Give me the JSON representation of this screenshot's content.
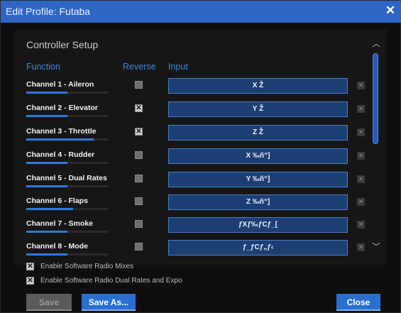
{
  "window": {
    "title": "Edit Profile: Futaba",
    "close_glyph": "✕"
  },
  "section_title": "Controller Setup",
  "columns": {
    "function": "Function",
    "reverse": "Reverse",
    "input": "Input"
  },
  "channels": [
    {
      "label": "Channel 1 - Aileron",
      "reverse": false,
      "input": "X Ž",
      "level": 0.5
    },
    {
      "label": "Channel 2 - Elevator",
      "reverse": true,
      "input": "Y Ž",
      "level": 0.5
    },
    {
      "label": "Channel 3 - Throttle",
      "reverse": true,
      "input": "Z Ž",
      "level": 0.82
    },
    {
      "label": "Channel 4 - Rudder",
      "reverse": false,
      "input": "X ‰ñ“]",
      "level": 0.5
    },
    {
      "label": "Channel 5 - Dual Rates",
      "reverse": false,
      "input": "Y ‰ñ“]",
      "level": 0.5
    },
    {
      "label": "Channel 6 - Flaps",
      "reverse": false,
      "input": "Z ‰ñ“]",
      "level": 0.57
    },
    {
      "label": "Channel 7 - Smoke",
      "reverse": false,
      "input": "ƒXƒ‰ƒCƒ_[",
      "level": 0.5
    },
    {
      "label": "Channel 8 - Mode",
      "reverse": false,
      "input": "ƒ_ƒCƒ„ƒ‹",
      "level": 0.5
    }
  ],
  "options": [
    {
      "label": "Enable Software Radio Mixes",
      "checked": true
    },
    {
      "label": "Enable Software Radio Dual Rates and Expo",
      "checked": true
    }
  ],
  "buttons": {
    "save": "Save",
    "save_as": "Save As...",
    "close": "Close"
  },
  "icons": {
    "check": "✕",
    "clear": "✕",
    "scroll_up": "chevron-up-icon",
    "scroll_down": "chevron-down-icon"
  },
  "colors": {
    "accent": "#2f66c6",
    "input_bg": "#1c3f73",
    "bar": "#2f7ad8",
    "heading": "#3f86d8"
  }
}
